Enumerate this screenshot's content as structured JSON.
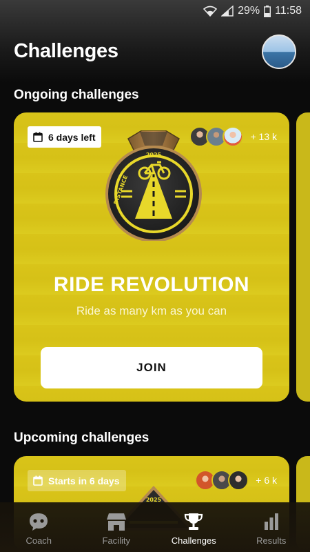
{
  "status": {
    "battery": "29%",
    "time": "11:58"
  },
  "header": {
    "title": "Challenges"
  },
  "sections": {
    "ongoing": "Ongoing challenges",
    "upcoming": "Upcoming challenges"
  },
  "ongoing_card": {
    "badge": "6 days left",
    "participants": "+ 13 k",
    "medal_year": "2025",
    "medal_label": "DISTANCE",
    "title": "RIDE REVOLUTION",
    "subtitle": "Ride as many km as you can",
    "button": "JOIN"
  },
  "upcoming_card": {
    "badge": "Starts in 6 days",
    "participants": "+ 6 k",
    "medal_year": "2025"
  },
  "tabs": [
    {
      "label": "Coach",
      "icon": "chat-bubble-icon"
    },
    {
      "label": "Facility",
      "icon": "storefront-icon"
    },
    {
      "label": "Challenges",
      "icon": "trophy-icon"
    },
    {
      "label": "Results",
      "icon": "bar-chart-icon"
    }
  ],
  "colors": {
    "card": "#d9c419",
    "background": "#0b0b0b",
    "tabbar": "#1c160c"
  }
}
